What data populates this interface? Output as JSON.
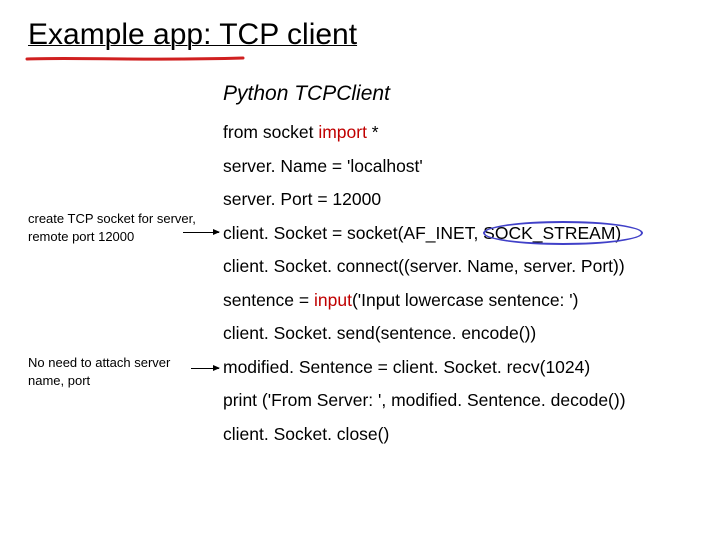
{
  "title": "Example app: TCP client",
  "subtitle": "Python TCPClient",
  "annotations": {
    "a1": "create TCP socket for server, remote port 12000",
    "a2": "No need to attach server name, port"
  },
  "code": {
    "l1_pre": "from socket ",
    "l1_kw": "import",
    "l1_post": " *",
    "l2": "server. Name = 'localhost'",
    "l3": "server. Port = 12000",
    "l4_pre": "client. Socket = socket(AF_INET, ",
    "l4_hl": "SOCK_STREAM",
    "l4_post": ")",
    "l5": "client. Socket. connect((server. Name, server. Port))",
    "l6_pre": "sentence = ",
    "l6_kw": "input",
    "l6_post": "('Input lowercase sentence: ')",
    "l7": "client. Socket. send(sentence. encode())",
    "l8": "modified. Sentence = client. Socket. recv(1024)",
    "l9": "print ('From Server: ', modified. Sentence. decode())",
    "l10": "client. Socket. close()"
  }
}
